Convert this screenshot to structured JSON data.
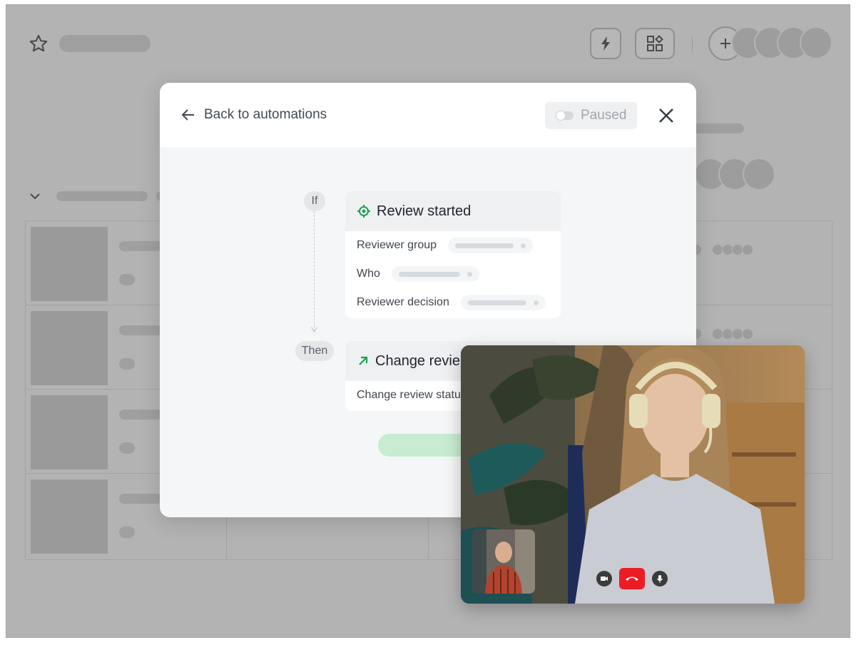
{
  "modal": {
    "back_label": "Back to automations",
    "status_label": "Paused",
    "if_label": "If",
    "then_label": "Then",
    "trigger": {
      "title": "Review started",
      "fields": [
        "Reviewer group",
        "Who",
        "Reviewer decision"
      ]
    },
    "action": {
      "title": "Change revie",
      "fields": [
        "Change review status"
      ]
    }
  },
  "colors": {
    "trigger_accent": "#1aa34a",
    "action_accent": "#1aa34a",
    "hangup": "#ec1c24"
  },
  "icons": {
    "star": "star-icon",
    "bolt": "lightning-icon",
    "apps": "apps-icon",
    "add": "plus-icon",
    "back": "arrow-left-icon",
    "close": "close-icon",
    "target": "target-icon",
    "arrow": "arrow-up-right-icon"
  }
}
